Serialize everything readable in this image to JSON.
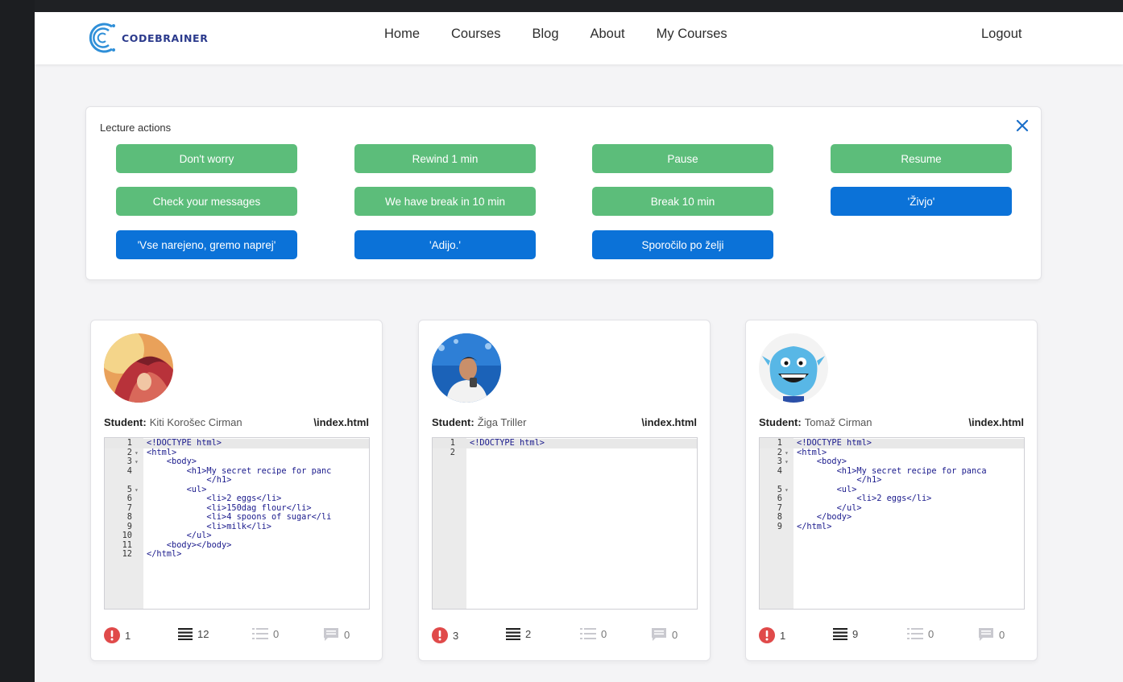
{
  "brand": {
    "name": "CODEBRAINER"
  },
  "nav": {
    "links": [
      "Home",
      "Courses",
      "Blog",
      "About",
      "My Courses"
    ],
    "logout": "Logout"
  },
  "lecture_actions": {
    "title": "Lecture actions",
    "buttons": [
      {
        "label": "Don't worry",
        "color": "#5cbd7a"
      },
      {
        "label": "Rewind 1 min",
        "color": "#5cbd7a"
      },
      {
        "label": "Pause",
        "color": "#5cbd7a"
      },
      {
        "label": "Resume",
        "color": "#5cbd7a"
      },
      {
        "label": "Check your messages",
        "color": "#5cbd7a"
      },
      {
        "label": "We have break in 10 min",
        "color": "#5cbd7a"
      },
      {
        "label": "Break 10 min",
        "color": "#5cbd7a"
      },
      {
        "label": "'Živjo'",
        "color": "#0b72d8"
      },
      {
        "label": "'Vse narejeno, gremo naprej'",
        "color": "#0b72d8"
      },
      {
        "label": "'Adijo.'",
        "color": "#0b72d8"
      },
      {
        "label": "Sporočilo po želji",
        "color": "#0b72d8"
      }
    ]
  },
  "students": [
    {
      "label": "Student:",
      "name": "Kiti Korošec Cirman",
      "file": "\\index.html",
      "code_lines": [
        {
          "n": "1",
          "fold": "",
          "text": "<!DOCTYPE html>"
        },
        {
          "n": "2",
          "fold": "▾",
          "text": "<html>"
        },
        {
          "n": "3",
          "fold": "▾",
          "text": "    <body>"
        },
        {
          "n": "4",
          "fold": "",
          "text": "        <h1>My secret recipe for panc"
        },
        {
          "n": "",
          "fold": "",
          "text": "            </h1>"
        },
        {
          "n": "5",
          "fold": "▾",
          "text": "        <ul>"
        },
        {
          "n": "6",
          "fold": "",
          "text": "            <li>2 eggs</li>"
        },
        {
          "n": "7",
          "fold": "",
          "text": "            <li>150dag flour</li>"
        },
        {
          "n": "8",
          "fold": "",
          "text": "            <li>4 spoons of sugar</li"
        },
        {
          "n": "9",
          "fold": "",
          "text": "            <li>milk</li>"
        },
        {
          "n": "10",
          "fold": "",
          "text": "        </ul>"
        },
        {
          "n": "11",
          "fold": "",
          "text": "    <body></body>"
        },
        {
          "n": "12",
          "fold": "",
          "text": "</html>"
        }
      ],
      "stats": {
        "errors": "1",
        "lines": "12",
        "list": "0",
        "messages": "0"
      }
    },
    {
      "label": "Student:",
      "name": "Žiga Triller",
      "file": "\\index.html",
      "code_lines": [
        {
          "n": "1",
          "fold": "",
          "text": "<!DOCTYPE html>"
        },
        {
          "n": "2",
          "fold": "",
          "text": ""
        }
      ],
      "stats": {
        "errors": "3",
        "lines": "2",
        "list": "0",
        "messages": "0"
      }
    },
    {
      "label": "Student:",
      "name": "Tomaž Cirman",
      "file": "\\index.html",
      "code_lines": [
        {
          "n": "1",
          "fold": "",
          "text": "<!DOCTYPE html>"
        },
        {
          "n": "2",
          "fold": "▾",
          "text": "<html>"
        },
        {
          "n": "3",
          "fold": "▾",
          "text": "    <body>"
        },
        {
          "n": "4",
          "fold": "",
          "text": "        <h1>My secret recipe for panca"
        },
        {
          "n": "",
          "fold": "",
          "text": "            </h1>"
        },
        {
          "n": "5",
          "fold": "▾",
          "text": "        <ul>"
        },
        {
          "n": "6",
          "fold": "",
          "text": "            <li>2 eggs</li>"
        },
        {
          "n": "7",
          "fold": "",
          "text": "        </ul>"
        },
        {
          "n": "8",
          "fold": "",
          "text": "    </body>"
        },
        {
          "n": "9",
          "fold": "",
          "text": "</html>"
        }
      ],
      "stats": {
        "errors": "1",
        "lines": "9",
        "list": "0",
        "messages": "0"
      }
    }
  ],
  "colors": {
    "green": "#5cbd7a",
    "blue": "#0b72d8",
    "error": "#e04a4a",
    "brand": "#2b3a8c"
  },
  "icons": [
    "codebrainer-logo",
    "close-icon",
    "error-icon",
    "lines-icon",
    "list-icon",
    "message-icon"
  ]
}
